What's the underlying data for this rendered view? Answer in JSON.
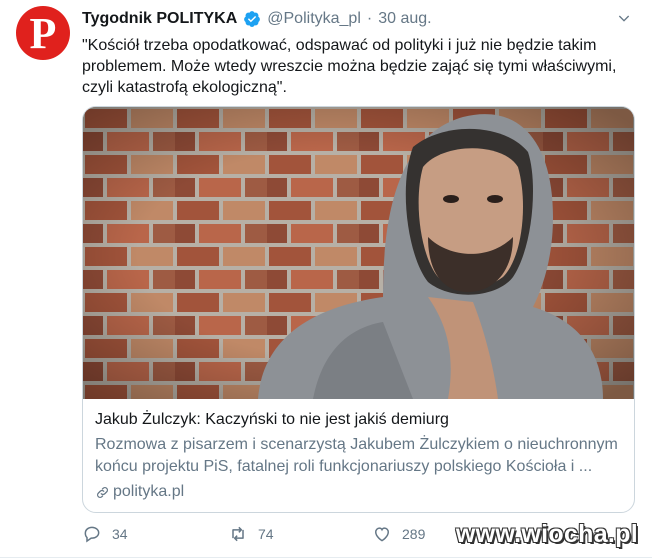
{
  "account": {
    "name": "Tygodnik POLITYKA",
    "handle": "@Polityka_pl",
    "separator": "·",
    "date": "30 aug.",
    "avatar_letter": "P",
    "avatar_color": "#e0211d",
    "verified_color": "#1da1f2"
  },
  "tweet": {
    "text": "\"Kościół trzeba opodatkować, odspawać od polityki i już nie będzie takim problemem. Może wtedy wreszcie można będzie zająć się tymi właściwymi, czyli katastrofą ekologiczną\"."
  },
  "card": {
    "image_icon": "photo-man-in-hoodie-brick-wall",
    "title": "Jakub Żulczyk: Kaczyński to nie jest jakiś demiurg",
    "description": "Rozmowa z pisarzem i scenarzystą Jakubem Żulczykiem o nieuchronnym końcu projektu PiS, fatalnej roli funkcjonariuszy polskiego Kościoła i ...",
    "domain": "polityka.pl"
  },
  "actions": {
    "reply_count": "34",
    "retweet_count": "74",
    "like_count": "289"
  },
  "watermark": "www.wiocha.pl"
}
